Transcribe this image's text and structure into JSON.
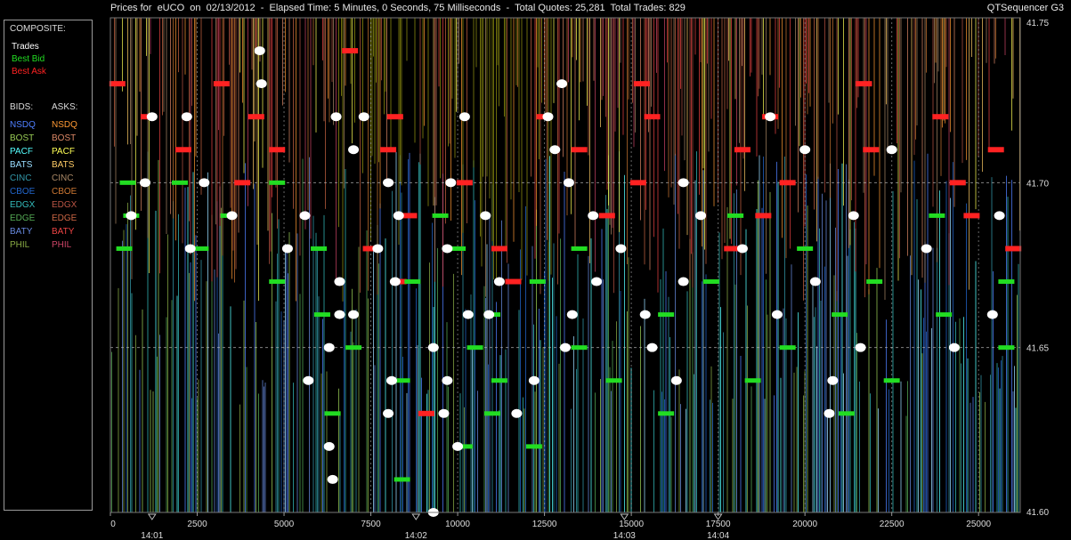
{
  "header": {
    "title": "Prices for  eUCO  on  02/13/2012  -  Elapsed Time: 5 Minutes, 0 Seconds, 75 Milliseconds  -  Total Quotes: 25,281  Total Trades: 829",
    "brand": "QTSequencer G3"
  },
  "legend": {
    "composite_label": "COMPOSITE:",
    "composite": [
      {
        "label": "Trades",
        "color": "#ffffff"
      },
      {
        "label": "Best Bid",
        "color": "#22dd22"
      },
      {
        "label": "Best Ask",
        "color": "#ff2222"
      }
    ],
    "bids_label": "BIDS:",
    "asks_label": "ASKS:",
    "exchanges": [
      {
        "name": "NSDQ",
        "bid_color": "#4f7fff",
        "ask_color": "#ff9933"
      },
      {
        "name": "BOST",
        "bid_color": "#99cc55",
        "ask_color": "#dd8866"
      },
      {
        "name": "PACF",
        "bid_color": "#55ffff",
        "ask_color": "#ffff55"
      },
      {
        "name": "BATS",
        "bid_color": "#99ddff",
        "ask_color": "#ffcc66"
      },
      {
        "name": "CINC",
        "bid_color": "#3399aa",
        "ask_color": "#aa8866"
      },
      {
        "name": "CBOE",
        "bid_color": "#2266cc",
        "ask_color": "#cc7733"
      },
      {
        "name": "EDGX",
        "bid_color": "#33bbbb",
        "ask_color": "#bb5544"
      },
      {
        "name": "EDGE",
        "bid_color": "#55aa55",
        "ask_color": "#cc6644"
      },
      {
        "name": "BATY",
        "bid_color": "#6688dd",
        "ask_color": "#ee4444"
      },
      {
        "name": "PHIL",
        "bid_color": "#88aa44",
        "ask_color": "#cc4466"
      }
    ]
  },
  "chart_data": {
    "type": "scatter",
    "title": "",
    "xlabel": "",
    "ylabel": "",
    "xlim": [
      0,
      26200
    ],
    "ylim": [
      41.6,
      41.75
    ],
    "x_ticks": [
      0,
      2500,
      5000,
      7500,
      10000,
      12500,
      15000,
      17500,
      20000,
      22500,
      25000
    ],
    "x_tick_labels": [
      "0",
      "2500",
      "5000",
      "7500",
      "10000",
      "12500",
      "15000",
      "17500",
      "20000",
      "22500",
      "25000"
    ],
    "time_markers": [
      {
        "x": 1200,
        "label": "14:01"
      },
      {
        "x": 8800,
        "label": "14:02"
      },
      {
        "x": 14800,
        "label": "14:03"
      },
      {
        "x": 17500,
        "label": "14:04"
      }
    ],
    "y_ticks": [
      41.6,
      41.65,
      41.7,
      41.75
    ],
    "y_tick_labels": [
      "41.60",
      "41.65",
      "41.70",
      "41.75"
    ],
    "background_color": "#000000",
    "trades": [
      [
        4300,
        41.74
      ],
      [
        4350,
        41.73
      ],
      [
        1200,
        41.72
      ],
      [
        2200,
        41.72
      ],
      [
        6500,
        41.72
      ],
      [
        7300,
        41.72
      ],
      [
        10200,
        41.72
      ],
      [
        12600,
        41.72
      ],
      [
        13000,
        41.73
      ],
      [
        19000,
        41.72
      ],
      [
        1000,
        41.7
      ],
      [
        2700,
        41.7
      ],
      [
        7000,
        41.71
      ],
      [
        8000,
        41.7
      ],
      [
        9800,
        41.7
      ],
      [
        12800,
        41.71
      ],
      [
        13200,
        41.7
      ],
      [
        16500,
        41.7
      ],
      [
        20000,
        41.71
      ],
      [
        22500,
        41.71
      ],
      [
        600,
        41.69
      ],
      [
        3500,
        41.69
      ],
      [
        5600,
        41.69
      ],
      [
        8300,
        41.69
      ],
      [
        10800,
        41.69
      ],
      [
        13900,
        41.69
      ],
      [
        17000,
        41.69
      ],
      [
        21400,
        41.69
      ],
      [
        25600,
        41.69
      ],
      [
        2300,
        41.68
      ],
      [
        5100,
        41.68
      ],
      [
        7700,
        41.68
      ],
      [
        9700,
        41.68
      ],
      [
        14700,
        41.68
      ],
      [
        18200,
        41.68
      ],
      [
        23500,
        41.68
      ],
      [
        6600,
        41.67
      ],
      [
        8200,
        41.67
      ],
      [
        11200,
        41.67
      ],
      [
        14000,
        41.67
      ],
      [
        16500,
        41.67
      ],
      [
        20300,
        41.67
      ],
      [
        6600,
        41.66
      ],
      [
        7000,
        41.66
      ],
      [
        10300,
        41.66
      ],
      [
        10900,
        41.66
      ],
      [
        13300,
        41.66
      ],
      [
        15400,
        41.66
      ],
      [
        19200,
        41.66
      ],
      [
        25400,
        41.66
      ],
      [
        6300,
        41.65
      ],
      [
        9300,
        41.65
      ],
      [
        13100,
        41.65
      ],
      [
        15600,
        41.65
      ],
      [
        21600,
        41.65
      ],
      [
        24300,
        41.65
      ],
      [
        5700,
        41.64
      ],
      [
        8100,
        41.64
      ],
      [
        9700,
        41.64
      ],
      [
        12200,
        41.64
      ],
      [
        16300,
        41.64
      ],
      [
        20800,
        41.64
      ],
      [
        8000,
        41.63
      ],
      [
        9600,
        41.63
      ],
      [
        11700,
        41.63
      ],
      [
        20700,
        41.63
      ],
      [
        6300,
        41.62
      ],
      [
        10000,
        41.62
      ],
      [
        6400,
        41.61
      ],
      [
        9300,
        41.6
      ]
    ],
    "best_bids": [
      [
        500,
        41.7
      ],
      [
        2000,
        41.7
      ],
      [
        4800,
        41.7
      ],
      [
        600,
        41.69
      ],
      [
        3400,
        41.69
      ],
      [
        9500,
        41.69
      ],
      [
        18000,
        41.69
      ],
      [
        23800,
        41.69
      ],
      [
        400,
        41.68
      ],
      [
        2600,
        41.68
      ],
      [
        6000,
        41.68
      ],
      [
        10000,
        41.68
      ],
      [
        13500,
        41.68
      ],
      [
        20000,
        41.68
      ],
      [
        4800,
        41.67
      ],
      [
        8700,
        41.67
      ],
      [
        12300,
        41.67
      ],
      [
        17300,
        41.67
      ],
      [
        22000,
        41.67
      ],
      [
        25800,
        41.67
      ],
      [
        6100,
        41.66
      ],
      [
        11000,
        41.66
      ],
      [
        16000,
        41.66
      ],
      [
        21000,
        41.66
      ],
      [
        24000,
        41.66
      ],
      [
        7000,
        41.65
      ],
      [
        10500,
        41.65
      ],
      [
        13500,
        41.65
      ],
      [
        19500,
        41.65
      ],
      [
        25800,
        41.65
      ],
      [
        8400,
        41.64
      ],
      [
        11200,
        41.64
      ],
      [
        14500,
        41.64
      ],
      [
        18500,
        41.64
      ],
      [
        22500,
        41.64
      ],
      [
        6400,
        41.63
      ],
      [
        11000,
        41.63
      ],
      [
        16000,
        41.63
      ],
      [
        21200,
        41.63
      ],
      [
        10200,
        41.62
      ],
      [
        12200,
        41.62
      ],
      [
        8400,
        41.61
      ]
    ],
    "best_asks": [
      [
        200,
        41.73
      ],
      [
        3200,
        41.73
      ],
      [
        6900,
        41.74
      ],
      [
        15300,
        41.73
      ],
      [
        21700,
        41.73
      ],
      [
        1100,
        41.72
      ],
      [
        4200,
        41.72
      ],
      [
        8200,
        41.72
      ],
      [
        12500,
        41.72
      ],
      [
        15600,
        41.72
      ],
      [
        19000,
        41.72
      ],
      [
        23900,
        41.72
      ],
      [
        2100,
        41.71
      ],
      [
        4800,
        41.71
      ],
      [
        8000,
        41.71
      ],
      [
        13500,
        41.71
      ],
      [
        18200,
        41.71
      ],
      [
        21900,
        41.71
      ],
      [
        25500,
        41.71
      ],
      [
        3800,
        41.7
      ],
      [
        10200,
        41.7
      ],
      [
        15200,
        41.7
      ],
      [
        19500,
        41.7
      ],
      [
        24400,
        41.7
      ],
      [
        8600,
        41.69
      ],
      [
        14300,
        41.69
      ],
      [
        18800,
        41.69
      ],
      [
        24800,
        41.69
      ],
      [
        7500,
        41.68
      ],
      [
        11200,
        41.68
      ],
      [
        17900,
        41.68
      ],
      [
        26000,
        41.68
      ],
      [
        8300,
        41.67
      ],
      [
        11600,
        41.67
      ],
      [
        9100,
        41.63
      ]
    ]
  }
}
